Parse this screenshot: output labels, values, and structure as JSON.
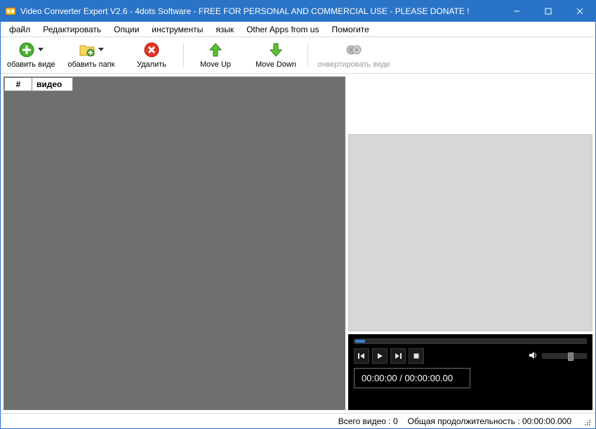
{
  "titlebar": {
    "title": "Video Converter Expert V2.6 - 4dots Software - FREE FOR PERSONAL AND COMMERCIAL USE - PLEASE DONATE !"
  },
  "menu": {
    "file": "файл",
    "edit": "Редактировать",
    "options": "Опции",
    "tools": "инструменты",
    "language": "язык",
    "other_apps": "Other Apps from us",
    "help": "Помогите"
  },
  "toolbar": {
    "add_video": "обавить виде",
    "add_folder": "обавить папк",
    "delete": "Удалить",
    "move_up": "Move Up",
    "move_down": "Move Down",
    "convert": "онвертировать виде"
  },
  "table": {
    "col_index": "#",
    "col_video": "видео"
  },
  "player": {
    "time_display": "00:00:00 / 00:00:00.00"
  },
  "status": {
    "total_videos_label": "Всего видео :",
    "total_videos_value": "0",
    "total_duration_label": "Общая продолжительность :",
    "total_duration_value": "00:00:00.000"
  }
}
